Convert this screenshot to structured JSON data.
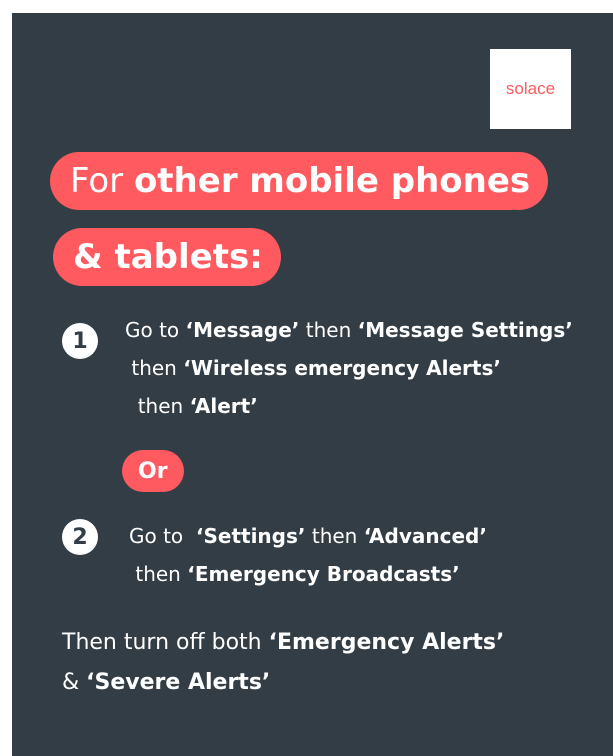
{
  "logo": {
    "text": "solace"
  },
  "heading": {
    "line1_regular": "For ",
    "line1_bold": "other mobile phones",
    "line2_bold": "& tablets:"
  },
  "step1": {
    "number": "1",
    "p1": "Go to ",
    "b1": "‘Message’",
    "p2": " then ",
    "b2": "‘Message Settings’",
    "p3": " then ",
    "b3": "‘Wireless emergency Alerts’",
    "p4": "  then ",
    "b4": "‘Alert’"
  },
  "or_label": "Or",
  "step2": {
    "number": "2",
    "p1": "Go to  ",
    "b1": "‘Settings’",
    "p2": " then ",
    "b2": "‘Advanced’",
    "p3": " then ",
    "b3": "‘Emergency Broadcasts’"
  },
  "final": {
    "p1": "Then turn off both ",
    "b1": "‘Emergency Alerts’",
    "p2": "& ",
    "b2": "‘Severe Alerts’"
  },
  "colors": {
    "background": "#333d45",
    "accent": "#ff5a5f",
    "text": "#ffffff"
  }
}
